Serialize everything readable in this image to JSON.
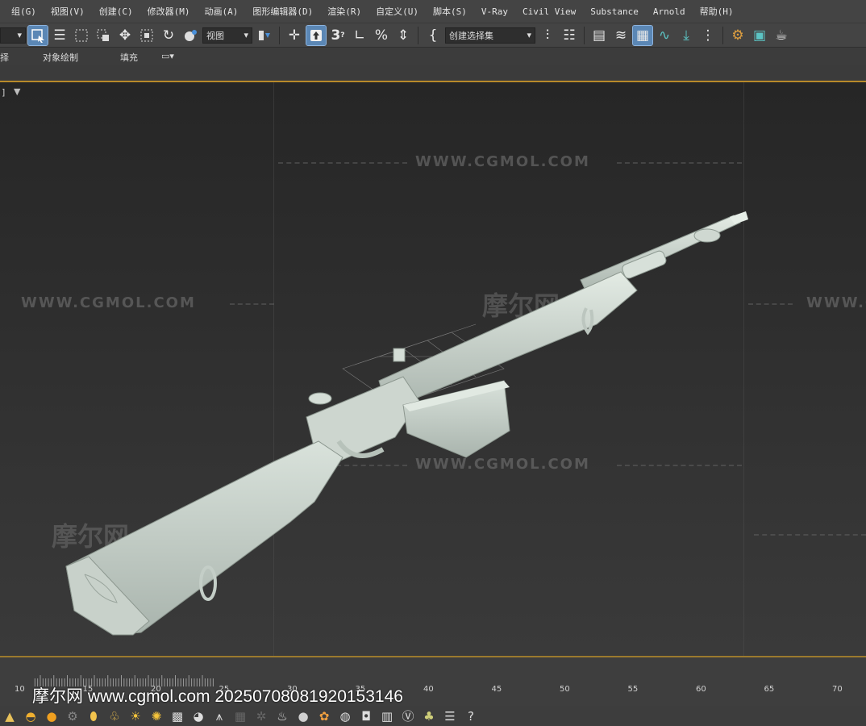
{
  "menu": {
    "items": [
      "组(G)",
      "视图(V)",
      "创建(C)",
      "修改器(M)",
      "动画(A)",
      "图形编辑器(D)",
      "渲染(R)",
      "自定义(U)",
      "脚本(S)",
      "V-Ray",
      "Civil View",
      "Substance",
      "Arnold",
      "帮助(H)"
    ]
  },
  "toolbar": {
    "view_dropdown": "视图",
    "selection_set_dropdown": "创建选择集",
    "snap_3_label": "3",
    "percent_label": "%"
  },
  "ribbon": {
    "tab_partial": "择",
    "tab_object_paint": "对象绘制",
    "tab_fill": "填充"
  },
  "viewport": {
    "label": "]",
    "watermark_url": "WWW.CGMOL.COM",
    "watermark_cn": "摩尔网"
  },
  "timeline": {
    "ticks": [
      "10",
      "15",
      "20",
      "25",
      "30",
      "35",
      "40",
      "45",
      "50",
      "55",
      "60",
      "65",
      "70"
    ],
    "overlay_text": "摩尔网 www.cgmol.com 20250708081920153146"
  },
  "colors": {
    "menu_bg": "#444444",
    "accent_active": "#5b87b5",
    "orange_border": "#b88a2a",
    "model_color": "#c9d3cc"
  }
}
